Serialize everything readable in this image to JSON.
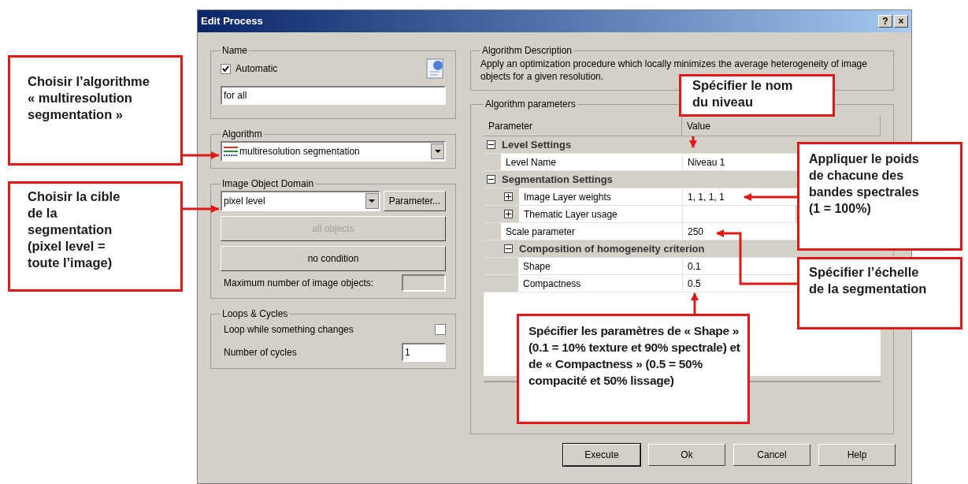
{
  "window": {
    "title": "Edit Process",
    "buttons": [
      "?",
      "×"
    ]
  },
  "name_group": {
    "label": "Name",
    "automatic": {
      "label": "Automatic",
      "checked": true
    },
    "value": "for all"
  },
  "algorithm": {
    "label": "Algorithm",
    "value": "multiresolution segmentation"
  },
  "domain": {
    "label": "Image Object Domain",
    "value": "pixel level",
    "parameter_button": "Parameter...",
    "objects_button": {
      "label": "all objects",
      "disabled": true
    },
    "condition_button": "no condition",
    "max_objects_label": "Maximum number of image objects:"
  },
  "loops": {
    "label": "Loops & Cycles",
    "loop": {
      "label": "Loop while something changes",
      "checked": false
    },
    "cycles_label": "Number of cycles",
    "cycles_value": "1"
  },
  "description": {
    "label": "Algorithm Description",
    "text": "Apply an optimization procedure which locally minimizes the average heterogeneity of image objects for a given resolution."
  },
  "parameters": {
    "label": "Algorithm parameters",
    "columns": [
      "Parameter",
      "Value"
    ],
    "rows": [
      {
        "name": "Level Settings",
        "expanded": true,
        "children": [
          {
            "name": "Level Name",
            "value": "Niveau 1"
          }
        ]
      },
      {
        "name": "Segmentation Settings",
        "expanded": true,
        "children": [
          {
            "name": "Image Layer weights",
            "expanded": false,
            "value": "1, 1, 1, 1"
          },
          {
            "name": "Thematic Layer usage",
            "expanded": false
          },
          {
            "name": "Scale parameter",
            "value": "250"
          },
          {
            "name": "Composition of homogeneity criterion",
            "expanded": true,
            "children": [
              {
                "name": "Shape",
                "value": "0.1"
              },
              {
                "name": "Compactness",
                "value": "0.5"
              }
            ]
          }
        ]
      }
    ]
  },
  "buttons": [
    "Execute",
    "Ok",
    "Cancel",
    "Help"
  ],
  "annotations": [
    {
      "text": "Choisir l’algorithme « multiresolution segmentation »"
    },
    {
      "text": "Choisir la cible de la segmentation (pixel level = toute l’image)"
    },
    {
      "text": "Spécifier le nom du niveau"
    },
    {
      "text": "Appliquer le poids de chacune des bandes spectrales (1 = 100%)"
    },
    {
      "text": "Spécifier l’échelle de la segmentation"
    },
    {
      "text": "Spécifier les paramètres de « Shape » (0.1 = 10% texture et 90% spectrale) et de « Compactness » (0.5 = 50% compacité et 50% lissage)"
    }
  ]
}
